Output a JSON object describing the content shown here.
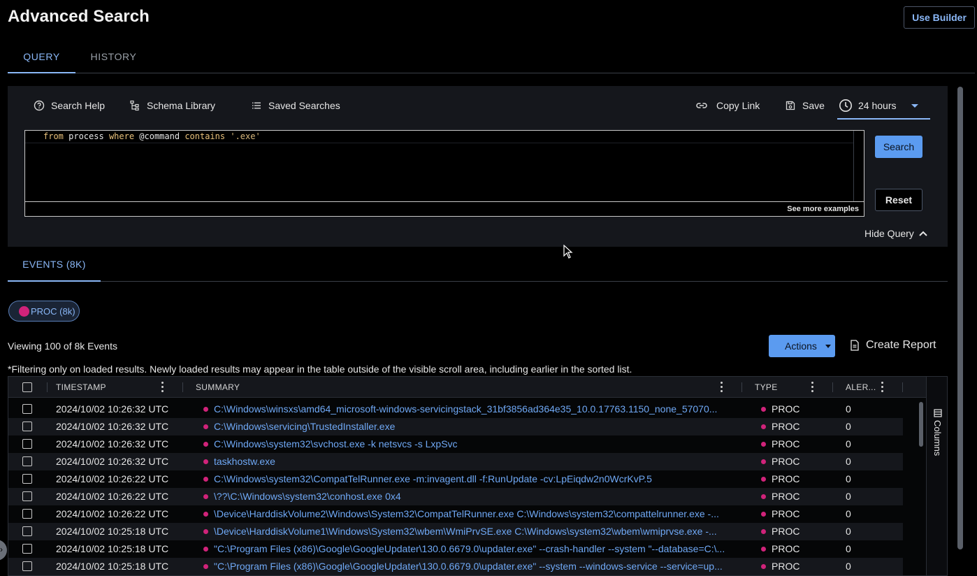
{
  "header": {
    "title": "Advanced Search",
    "use_builder_label": "Use Builder"
  },
  "top_tabs": [
    "QUERY",
    "HISTORY"
  ],
  "query_toolbar": {
    "search_help": "Search Help",
    "schema_library": "Schema Library",
    "saved_searches": "Saved Searches",
    "copy_link": "Copy Link",
    "save": "Save",
    "time_range": "24 hours"
  },
  "editor": {
    "query": "from process where @command contains '.exe'",
    "see_more": "See more examples"
  },
  "buttons": {
    "search": "Search",
    "reset": "Reset",
    "hide_query": "Hide Query"
  },
  "events": {
    "tab_label": "EVENTS (8K)",
    "chip_label": "PROC (8k)",
    "viewing_text": "Viewing 100 of 8k Events",
    "actions_label": "Actions",
    "create_report_label": "Create Report",
    "filter_note": "*Filtering only on loaded results.  Newly loaded results may appear in the table outside of the visible scroll area, including earlier in the sorted list.",
    "columns_label": "Columns"
  },
  "table": {
    "columns": [
      "TIMESTAMP",
      "SUMMARY",
      "TYPE",
      "ALER..."
    ],
    "rows": [
      {
        "timestamp": "2024/10/02 10:26:32 UTC",
        "summary": "C:\\Windows\\winsxs\\amd64_microsoft-windows-servicingstack_31bf3856ad364e35_10.0.17763.1150_none_57070...",
        "type": "PROC",
        "alerts": "0"
      },
      {
        "timestamp": "2024/10/02 10:26:32 UTC",
        "summary": "C:\\Windows\\servicing\\TrustedInstaller.exe",
        "type": "PROC",
        "alerts": "0"
      },
      {
        "timestamp": "2024/10/02 10:26:32 UTC",
        "summary": "C:\\Windows\\system32\\svchost.exe -k netsvcs -s LxpSvc",
        "type": "PROC",
        "alerts": "0"
      },
      {
        "timestamp": "2024/10/02 10:26:32 UTC",
        "summary": "taskhostw.exe",
        "type": "PROC",
        "alerts": "0"
      },
      {
        "timestamp": "2024/10/02 10:26:22 UTC",
        "summary": "C:\\Windows\\system32\\CompatTelRunner.exe -m:invagent.dll -f:RunUpdate -cv:LpEiqdw2n0WcrKvP.5",
        "type": "PROC",
        "alerts": "0"
      },
      {
        "timestamp": "2024/10/02 10:26:22 UTC",
        "summary": "\\??\\C:\\Windows\\system32\\conhost.exe 0x4",
        "type": "PROC",
        "alerts": "0"
      },
      {
        "timestamp": "2024/10/02 10:26:22 UTC",
        "summary": "\\Device\\HarddiskVolume2\\Windows\\System32\\CompatTelRunner.exe C:\\Windows\\system32\\compattelrunner.exe -...",
        "type": "PROC",
        "alerts": "0"
      },
      {
        "timestamp": "2024/10/02 10:25:18 UTC",
        "summary": "\\Device\\HarddiskVolume1\\Windows\\System32\\wbem\\WmiPrvSE.exe C:\\Windows\\system32\\wbem\\wmiprvse.exe -...",
        "type": "PROC",
        "alerts": "0"
      },
      {
        "timestamp": "2024/10/02 10:25:18 UTC",
        "summary": "\"C:\\Program Files (x86)\\Google\\GoogleUpdater\\130.0.6679.0\\updater.exe\" --crash-handler --system \"--database=C:\\...",
        "type": "PROC",
        "alerts": "0"
      },
      {
        "timestamp": "2024/10/02 10:25:18 UTC",
        "summary": "\"C:\\Program Files (x86)\\Google\\GoogleUpdater\\130.0.6679.0\\updater.exe\" --system --windows-service --service=up...",
        "type": "PROC",
        "alerts": "0"
      }
    ]
  },
  "colors": {
    "accent": "#8ab7f7",
    "primary_button": "#5b9bf0",
    "proc_dot": "#d0237a",
    "link": "#6fa8f5"
  },
  "icons": [
    "help-circle-icon",
    "schema-tree-icon",
    "list-icon",
    "link-icon",
    "save-disk-icon",
    "clock-icon",
    "chevron-up-icon",
    "document-icon",
    "columns-icon",
    "chevron-right-icon"
  ]
}
